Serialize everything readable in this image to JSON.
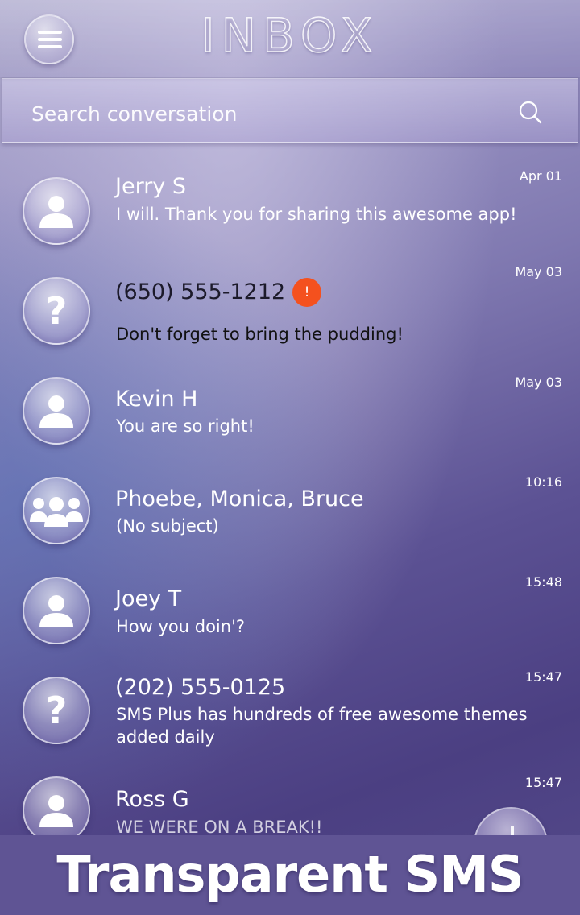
{
  "header": {
    "title": "INBOX",
    "menu_icon": "hamburger-menu-icon"
  },
  "search": {
    "placeholder": "Search conversation",
    "icon": "search-icon"
  },
  "conversations": [
    {
      "name": "Jerry S",
      "preview": " I will. Thank you for sharing this awesome app!",
      "time": "Apr 01",
      "avatar": "person-icon",
      "unread": false
    },
    {
      "name": "(650) 555-1212",
      "preview": "Don't forget to bring the pudding!",
      "time": "May 03",
      "avatar": "unknown-contact-icon",
      "unread": true,
      "badge": "!"
    },
    {
      "name": "Kevin H",
      "preview": "You are so right!",
      "time": "May 03",
      "avatar": "person-icon",
      "unread": false
    },
    {
      "name": "Phoebe, Monica, Bruce",
      "preview": "(No subject)",
      "time": "10:16",
      "avatar": "group-icon",
      "unread": false
    },
    {
      "name": "Joey T",
      "preview": " How you doin'?",
      "time": "15:48",
      "avatar": "person-icon",
      "unread": false
    },
    {
      "name": "(202) 555-0125",
      "preview": " SMS Plus has hundreds of free awesome themes added daily",
      "time": "15:47",
      "avatar": "unknown-contact-icon",
      "unread": false
    },
    {
      "name": "Ross G",
      "preview": " WE WERE ON A BREAK!!",
      "time": "15:47",
      "avatar": "person-icon",
      "unread": false
    }
  ],
  "banner": {
    "text": "Transparent SMS"
  },
  "colors": {
    "badge": "#f4511e",
    "banner_bg": "#5f5494"
  }
}
